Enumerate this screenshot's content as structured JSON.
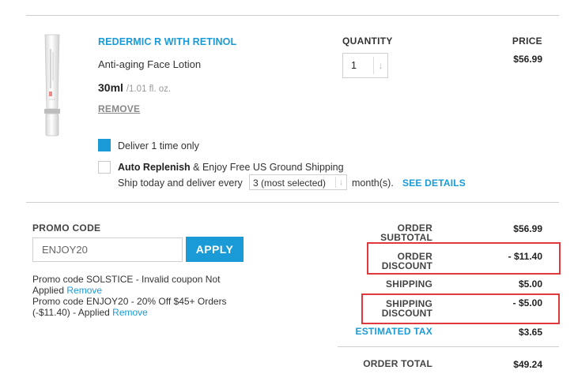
{
  "product": {
    "name": "REDERMIC R WITH RETINOL",
    "subtitle": "Anti-aging Face Lotion",
    "size": "30ml",
    "size_oz": "/1.01 fl. oz.",
    "remove_label": "REMOVE",
    "quantity_label": "QUANTITY",
    "quantity_value": "1",
    "price_label": "PRICE",
    "price_value": "$56.99"
  },
  "delivery": {
    "once_label": "Deliver 1 time only",
    "once_checked": true,
    "auto_bold": "Auto Replenish",
    "auto_rest": " & Enjoy Free US Ground Shipping",
    "auto_checked": false,
    "ship_prefix": "Ship today and deliver every",
    "frequency_value": "3 (most selected)",
    "ship_suffix": "month(s).",
    "see_details": "SEE DETAILS"
  },
  "promo": {
    "label": "PROMO CODE",
    "input_value": "ENJOY20",
    "apply_label": "APPLY",
    "messages": [
      {
        "line1": "Promo code SOLSTICE - Invalid coupon Not",
        "line2": "Applied ",
        "link": "Remove"
      },
      {
        "line1": "Promo code ENJOY20 - 20% Off $45+ Orders",
        "line2": "(-$11.40) - Applied ",
        "link": "Remove"
      }
    ]
  },
  "summary": {
    "subtotal_l1": "ORDER",
    "subtotal_l2": "SUBTOTAL",
    "subtotal_value": "$56.99",
    "order_discount_l1": "ORDER",
    "order_discount_l2": "DISCOUNT",
    "order_discount_value": "- $11.40",
    "shipping_label": "SHIPPING",
    "shipping_value": "$5.00",
    "shipping_discount_l1": "SHIPPING",
    "shipping_discount_l2": "DISCOUNT",
    "shipping_discount_value": "- $5.00",
    "tax_label": "ESTIMATED TAX",
    "tax_value": "$3.65",
    "total_label": "ORDER TOTAL",
    "total_value": "$49.24"
  },
  "icons": {
    "quantity_arrow": "down-arrow-icon",
    "frequency_arrow": "down-arrow-icon",
    "product_image": "lotion-tube-image"
  },
  "colors": {
    "accent": "#1a9bd7",
    "highlight": "#e0383b"
  }
}
